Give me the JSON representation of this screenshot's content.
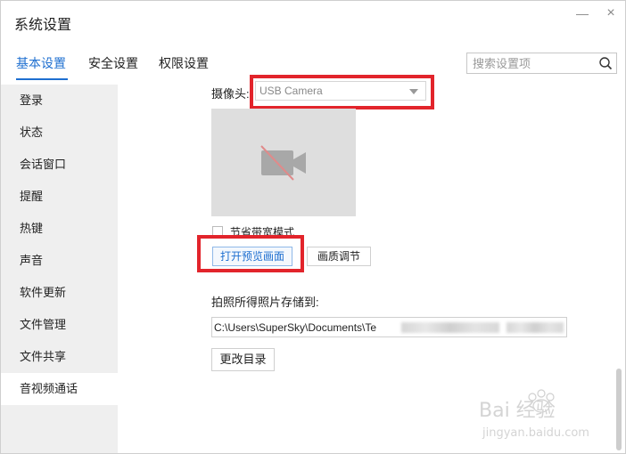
{
  "window": {
    "title": "系统设置"
  },
  "tabs": [
    {
      "label": "基本设置"
    },
    {
      "label": "安全设置"
    },
    {
      "label": "权限设置"
    }
  ],
  "search": {
    "placeholder": "搜索设置项",
    "value": ""
  },
  "sidebar": {
    "items": [
      {
        "label": "登录"
      },
      {
        "label": "状态"
      },
      {
        "label": "会话窗口"
      },
      {
        "label": "提醒"
      },
      {
        "label": "热键"
      },
      {
        "label": "声音"
      },
      {
        "label": "软件更新"
      },
      {
        "label": "文件管理"
      },
      {
        "label": "文件共享"
      },
      {
        "label": "音视频通话"
      }
    ],
    "active_index": 9
  },
  "camera": {
    "label": "摄像头:",
    "selected": "USB Camera",
    "low_bandwidth_label": "节省带宽模式",
    "preview_button": "打开预览画面",
    "quality_button": "画质调节"
  },
  "photo": {
    "save_label": "拍照所得照片存储到:",
    "path_visible": "C:\\Users\\SuperSky\\Documents\\Te",
    "change_dir_button": "更改目录"
  },
  "watermark": {
    "text_main": "Bai  经验",
    "text_sub": "jingyan.baidu.com"
  },
  "colors": {
    "accent": "#1e6fd0",
    "highlight": "#e2242b",
    "sidebar_bg": "#efefef"
  }
}
